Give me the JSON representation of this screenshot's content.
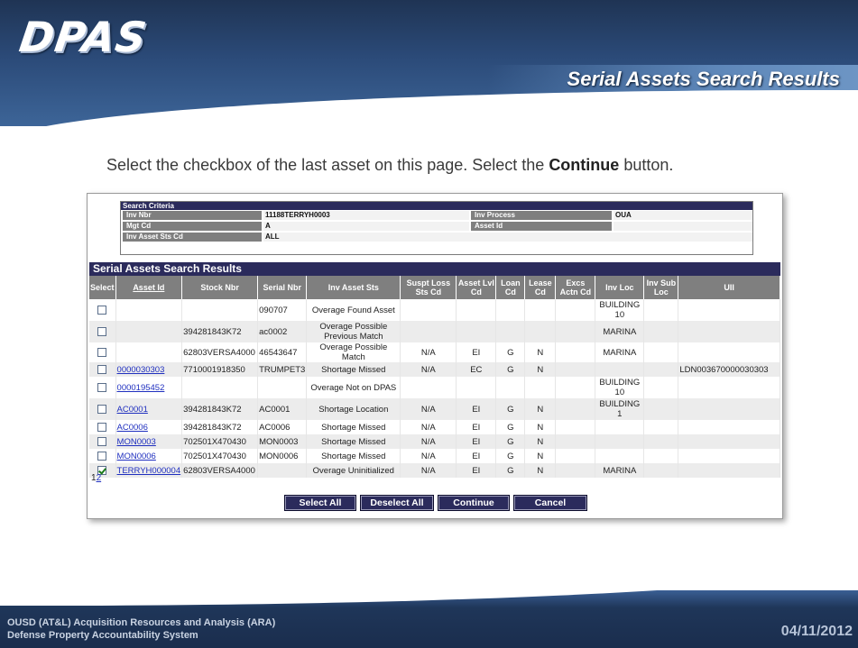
{
  "slide": {
    "logo": "DPAS",
    "title": "Serial Assets Search Results",
    "instruction_pre": "Select the checkbox of the last asset on this page. Select the ",
    "instruction_bold": "Continue",
    "instruction_post": " button.",
    "footer_line1": "OUSD (AT&L) Acquisition Resources and Analysis (ARA)",
    "footer_line2": "Defense Property Accountability System",
    "date": "04/11/2012"
  },
  "criteria": {
    "heading": "Search Criteria",
    "inv_nbr_label": "Inv Nbr",
    "inv_nbr_value": "11188TERRYH0003",
    "inv_process_label": "Inv Process",
    "inv_process_value": "OUA",
    "mgt_cd_label": "Mgt Cd",
    "mgt_cd_value": "A",
    "asset_id_label": "Asset Id",
    "asset_id_value": "",
    "inv_asset_sts_label": "Inv Asset Sts Cd",
    "inv_asset_sts_value": "ALL"
  },
  "results": {
    "title": "Serial Assets Search Results",
    "columns": [
      "Select",
      "Asset Id",
      "Stock Nbr",
      "Serial Nbr",
      "Inv Asset Sts",
      "Suspt Loss Sts Cd",
      "Asset Lvl Cd",
      "Loan Cd",
      "Lease Cd",
      "Excs Actn Cd",
      "Inv Loc",
      "Inv Sub Loc",
      "UII"
    ],
    "rows": [
      {
        "checked": false,
        "asset_id": "",
        "stock_nbr": "",
        "serial_nbr": "090707",
        "sts": "Overage Found Asset",
        "loss": "",
        "lvl": "",
        "loan": "",
        "lease": "",
        "excs": "",
        "loc": "BUILDING 10",
        "subloc": "",
        "uii": ""
      },
      {
        "checked": false,
        "asset_id": "",
        "stock_nbr": "394281843K72",
        "serial_nbr": "ac0002",
        "sts": "Overage Possible Previous Match",
        "loss": "",
        "lvl": "",
        "loan": "",
        "lease": "",
        "excs": "",
        "loc": "MARINA",
        "subloc": "",
        "uii": ""
      },
      {
        "checked": false,
        "asset_id": "",
        "stock_nbr": "62803VERSA4000",
        "serial_nbr": "46543647",
        "sts": "Overage Possible Match",
        "loss": "N/A",
        "lvl": "EI",
        "loan": "G",
        "lease": "N",
        "excs": "",
        "loc": "MARINA",
        "subloc": "",
        "uii": ""
      },
      {
        "checked": false,
        "asset_id": "0000030303",
        "stock_nbr": "7710001918350",
        "serial_nbr": "TRUMPET3",
        "sts": "Shortage Missed",
        "loss": "N/A",
        "lvl": "EC",
        "loan": "G",
        "lease": "N",
        "excs": "",
        "loc": "",
        "subloc": "",
        "uii": "LDN003670000030303"
      },
      {
        "checked": false,
        "asset_id": "0000195452",
        "stock_nbr": "",
        "serial_nbr": "",
        "sts": "Overage Not on DPAS",
        "loss": "",
        "lvl": "",
        "loan": "",
        "lease": "",
        "excs": "",
        "loc": "BUILDING 10",
        "subloc": "",
        "uii": ""
      },
      {
        "checked": false,
        "asset_id": "AC0001",
        "stock_nbr": "394281843K72",
        "serial_nbr": "AC0001",
        "sts": "Shortage Location",
        "loss": "N/A",
        "lvl": "EI",
        "loan": "G",
        "lease": "N",
        "excs": "",
        "loc": "BUILDING 1",
        "subloc": "",
        "uii": ""
      },
      {
        "checked": false,
        "asset_id": "AC0006",
        "stock_nbr": "394281843K72",
        "serial_nbr": "AC0006",
        "sts": "Shortage Missed",
        "loss": "N/A",
        "lvl": "EI",
        "loan": "G",
        "lease": "N",
        "excs": "",
        "loc": "",
        "subloc": "",
        "uii": ""
      },
      {
        "checked": false,
        "asset_id": "MON0003",
        "stock_nbr": "702501X470430",
        "serial_nbr": "MON0003",
        "sts": "Shortage Missed",
        "loss": "N/A",
        "lvl": "EI",
        "loan": "G",
        "lease": "N",
        "excs": "",
        "loc": "",
        "subloc": "",
        "uii": ""
      },
      {
        "checked": false,
        "asset_id": "MON0006",
        "stock_nbr": "702501X470430",
        "serial_nbr": "MON0006",
        "sts": "Shortage Missed",
        "loss": "N/A",
        "lvl": "EI",
        "loan": "G",
        "lease": "N",
        "excs": "",
        "loc": "",
        "subloc": "",
        "uii": ""
      },
      {
        "checked": true,
        "asset_id": "TERRYH000004",
        "stock_nbr": "62803VERSA4000",
        "serial_nbr": "",
        "sts": "Overage Uninitialized",
        "loss": "N/A",
        "lvl": "EI",
        "loan": "G",
        "lease": "N",
        "excs": "",
        "loc": "MARINA",
        "subloc": "",
        "uii": ""
      }
    ],
    "pager_current": "1",
    "pager_next": "2"
  },
  "buttons": {
    "select_all": "Select All",
    "deselect_all": "Deselect All",
    "continue": "Continue",
    "cancel": "Cancel"
  },
  "colors": {
    "app_header": "#2b2b5c",
    "column_header": "#7f7f7f",
    "link": "#1f2fbf"
  }
}
